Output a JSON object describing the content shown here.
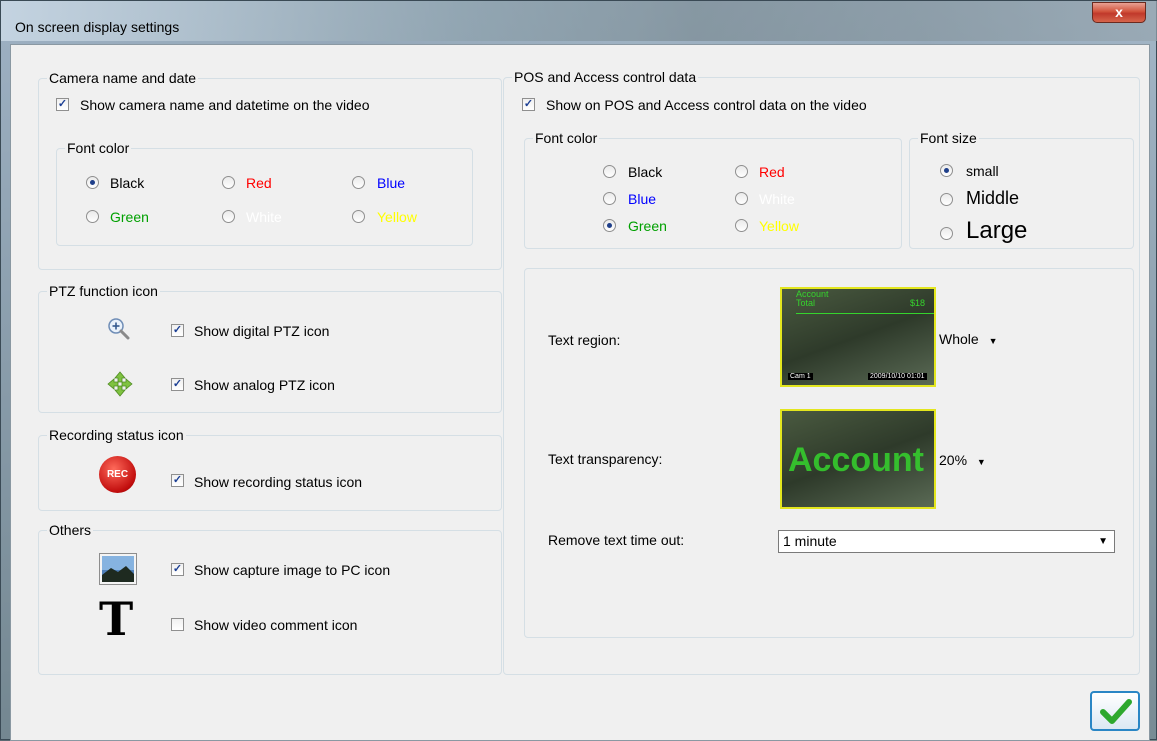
{
  "window": {
    "title": "On screen display settings",
    "close_label": "x"
  },
  "camera_group": {
    "title": "Camera name and date",
    "checkbox_label": "Show camera name and datetime on the video",
    "font_color_title": "Font color",
    "colors": {
      "black": "Black",
      "red": "Red",
      "blue": "Blue",
      "green": "Green",
      "white": "White",
      "yellow": "Yellow"
    },
    "selected": "Black"
  },
  "ptz_group": {
    "title": "PTZ function icon",
    "digital_label": "Show digital PTZ icon",
    "analog_label": "Show analog PTZ icon"
  },
  "recording_group": {
    "title": "Recording status icon",
    "icon_text": "REC",
    "label": "Show recording status icon"
  },
  "others_group": {
    "title": "Others",
    "capture_label": "Show capture image to PC icon",
    "comment_label": "Show video comment icon",
    "comment_icon_glyph": "T"
  },
  "pos_group": {
    "title": "POS and Access control data",
    "checkbox_label": "Show on POS and Access control data on the video",
    "font_color_title": "Font color",
    "colors": {
      "black": "Black",
      "red": "Red",
      "blue": "Blue",
      "white": "White",
      "green": "Green",
      "yellow": "Yellow"
    },
    "selected_color": "Green",
    "font_size_title": "Font size",
    "sizes": {
      "small": "small",
      "middle": "Middle",
      "large": "Large"
    },
    "selected_size": "small",
    "text_region_label": "Text region:",
    "text_region_value": "Whole",
    "text_region_preview": {
      "line1": "Account",
      "line2": "Total",
      "right": "$18",
      "bottom_left": "Cam 1",
      "bottom_right": "2009/10/10 01:01"
    },
    "text_transparency_label": "Text transparency:",
    "text_transparency_value": "20%",
    "transparency_preview_text": "Account",
    "remove_timeout_label": "Remove text time out:",
    "remove_timeout_value": "1 minute"
  },
  "palette": {
    "black": "#000000",
    "red": "#ff0000",
    "blue": "#0000ff",
    "green": "#00a000",
    "white": "#ffffff",
    "yellow": "#ffff00",
    "preview_green": "#35d42d",
    "ok_check": "#2ea82e"
  }
}
